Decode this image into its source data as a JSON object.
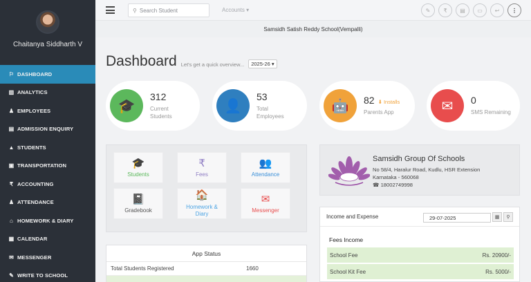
{
  "user": {
    "name": "Chaitanya Siddharth V"
  },
  "sidebar": {
    "items": [
      {
        "icon": "bookmark-icon",
        "glyph": "⚐",
        "label": "DASHBOARD",
        "active": true
      },
      {
        "icon": "bar-chart-icon",
        "glyph": "▥",
        "label": "ANALYTICS"
      },
      {
        "icon": "user-icon",
        "glyph": "♟",
        "label": "EMPLOYEES"
      },
      {
        "icon": "database-icon",
        "glyph": "▤",
        "label": "ADMISSION ENQUIRY"
      },
      {
        "icon": "graduation-cap-icon",
        "glyph": "▲",
        "label": "STUDENTS"
      },
      {
        "icon": "bus-icon",
        "glyph": "▣",
        "label": "TRANSPORTATION"
      },
      {
        "icon": "rupee-icon",
        "glyph": "₹",
        "label": "ACCOUNTING"
      },
      {
        "icon": "users-icon",
        "glyph": "♟",
        "label": "ATTENDANCE"
      },
      {
        "icon": "home-icon",
        "glyph": "⌂",
        "label": "HOMEWORK & DIARY"
      },
      {
        "icon": "calendar-icon",
        "glyph": "▦",
        "label": "CALENDAR"
      },
      {
        "icon": "envelope-icon",
        "glyph": "✉",
        "label": "MESSENGER"
      },
      {
        "icon": "pencil-icon",
        "glyph": "✎",
        "label": "WRITE TO SCHOOL"
      }
    ]
  },
  "topbar": {
    "search_placeholder": "Search Student",
    "accounts_label": "Accounts ▾",
    "icons": [
      {
        "name": "edit-icon",
        "glyph": "✎"
      },
      {
        "name": "rupee-circle-icon",
        "glyph": "₹"
      },
      {
        "name": "document-icon",
        "glyph": "▤"
      },
      {
        "name": "id-card-icon",
        "glyph": "▭"
      },
      {
        "name": "reply-icon",
        "glyph": "↩"
      },
      {
        "name": "more-vertical-icon",
        "glyph": "⋮"
      }
    ]
  },
  "school_name": "Samsidh Satish Reddy School(Vempalli)",
  "dashboard": {
    "title": "Dashboard",
    "subtitle": "Let's get a quick overview...",
    "year": "2025-26 ▾"
  },
  "stats": [
    {
      "value": "312",
      "label_line1": "Current",
      "label_line2": "Students",
      "color": "#5cb85c",
      "icon": "graduation-cap-icon",
      "glyph": "🎓"
    },
    {
      "value": "53",
      "label_line1": "Total",
      "label_line2": "Employees",
      "color": "#2f7fbf",
      "icon": "user-icon",
      "glyph": "👤"
    },
    {
      "value": "82",
      "extra": "⬇ Installs",
      "label_line1": "Parents App",
      "label_line2": "",
      "color": "#f0a23a",
      "icon": "android-icon",
      "glyph": "🤖"
    },
    {
      "value": "0",
      "label_line1": "SMS Remaining",
      "label_line2": "",
      "color": "#e84d4d",
      "icon": "envelope-icon",
      "glyph": "✉"
    }
  ],
  "quick_links": [
    {
      "label": "Students",
      "color": "#5cb85c",
      "icon": "graduation-cap-icon",
      "glyph": "🎓"
    },
    {
      "label": "Fees",
      "color": "#8e7cc3",
      "icon": "rupee-icon",
      "glyph": "₹"
    },
    {
      "label": "Attendance",
      "color": "#3a8fd8",
      "icon": "users-icon",
      "glyph": "👥"
    },
    {
      "label": "Gradebook",
      "color": "#555555",
      "icon": "book-icon",
      "glyph": "📓"
    },
    {
      "label": "Homework &\nDiary",
      "color": "#4ba3e3",
      "icon": "home-icon",
      "glyph": "🏠"
    },
    {
      "label": "Messenger",
      "color": "#e84d4d",
      "icon": "envelope-icon",
      "glyph": "✉"
    }
  ],
  "app_status": {
    "title": "App Status",
    "rows": [
      {
        "label": "Total Students Registered",
        "value": "1660"
      }
    ]
  },
  "school_card": {
    "title": "Samsidh Group Of Schools",
    "address1": "No 58/4, Haralur Road, Kudlu, HSR Extension",
    "address2": "Karnataka - 560068",
    "phone": "☎ 18002749998"
  },
  "income": {
    "title": "Income and Expense",
    "date": "29-07-2025",
    "section": "Fees Income",
    "rows": [
      {
        "label": "School Fee",
        "value": "Rs. 20900/-"
      },
      {
        "label": "School Kit Fee",
        "value": "Rs. 5000/-"
      }
    ]
  }
}
